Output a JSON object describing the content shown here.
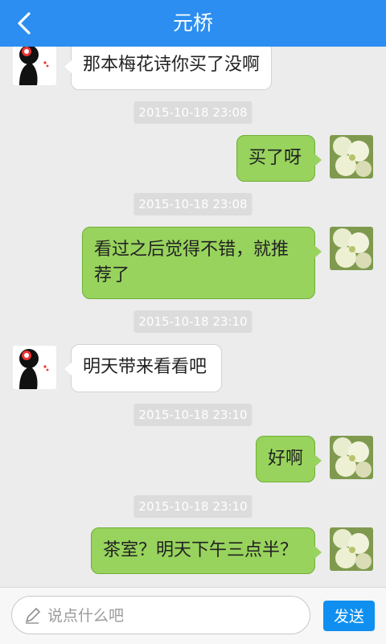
{
  "header": {
    "title": "元桥",
    "back_icon": "chevron-left-icon"
  },
  "messages": [
    {
      "type": "in",
      "text": "那本梅花诗你买了没啊"
    },
    {
      "type": "time",
      "text": "2015-10-18 23:08"
    },
    {
      "type": "out",
      "text": "买了呀"
    },
    {
      "type": "time",
      "text": "2015-10-18 23:08"
    },
    {
      "type": "out",
      "text": "看过之后觉得不错，就推荐了"
    },
    {
      "type": "time",
      "text": "2015-10-18 23:10"
    },
    {
      "type": "in",
      "text": "明天带来看看吧"
    },
    {
      "type": "time",
      "text": "2015-10-18 23:10"
    },
    {
      "type": "out",
      "text": "好啊"
    },
    {
      "type": "time",
      "text": "2015-10-18 23:10"
    },
    {
      "type": "out",
      "text": "茶室？明天下午三点半？"
    }
  ],
  "composer": {
    "placeholder": "说点什么吧",
    "send_label": "发送",
    "icon": "pencil-icon"
  },
  "colors": {
    "header": "#2b8ef0",
    "outgoing_bubble": "#98d35d",
    "send_button": "#0f8ff0"
  }
}
